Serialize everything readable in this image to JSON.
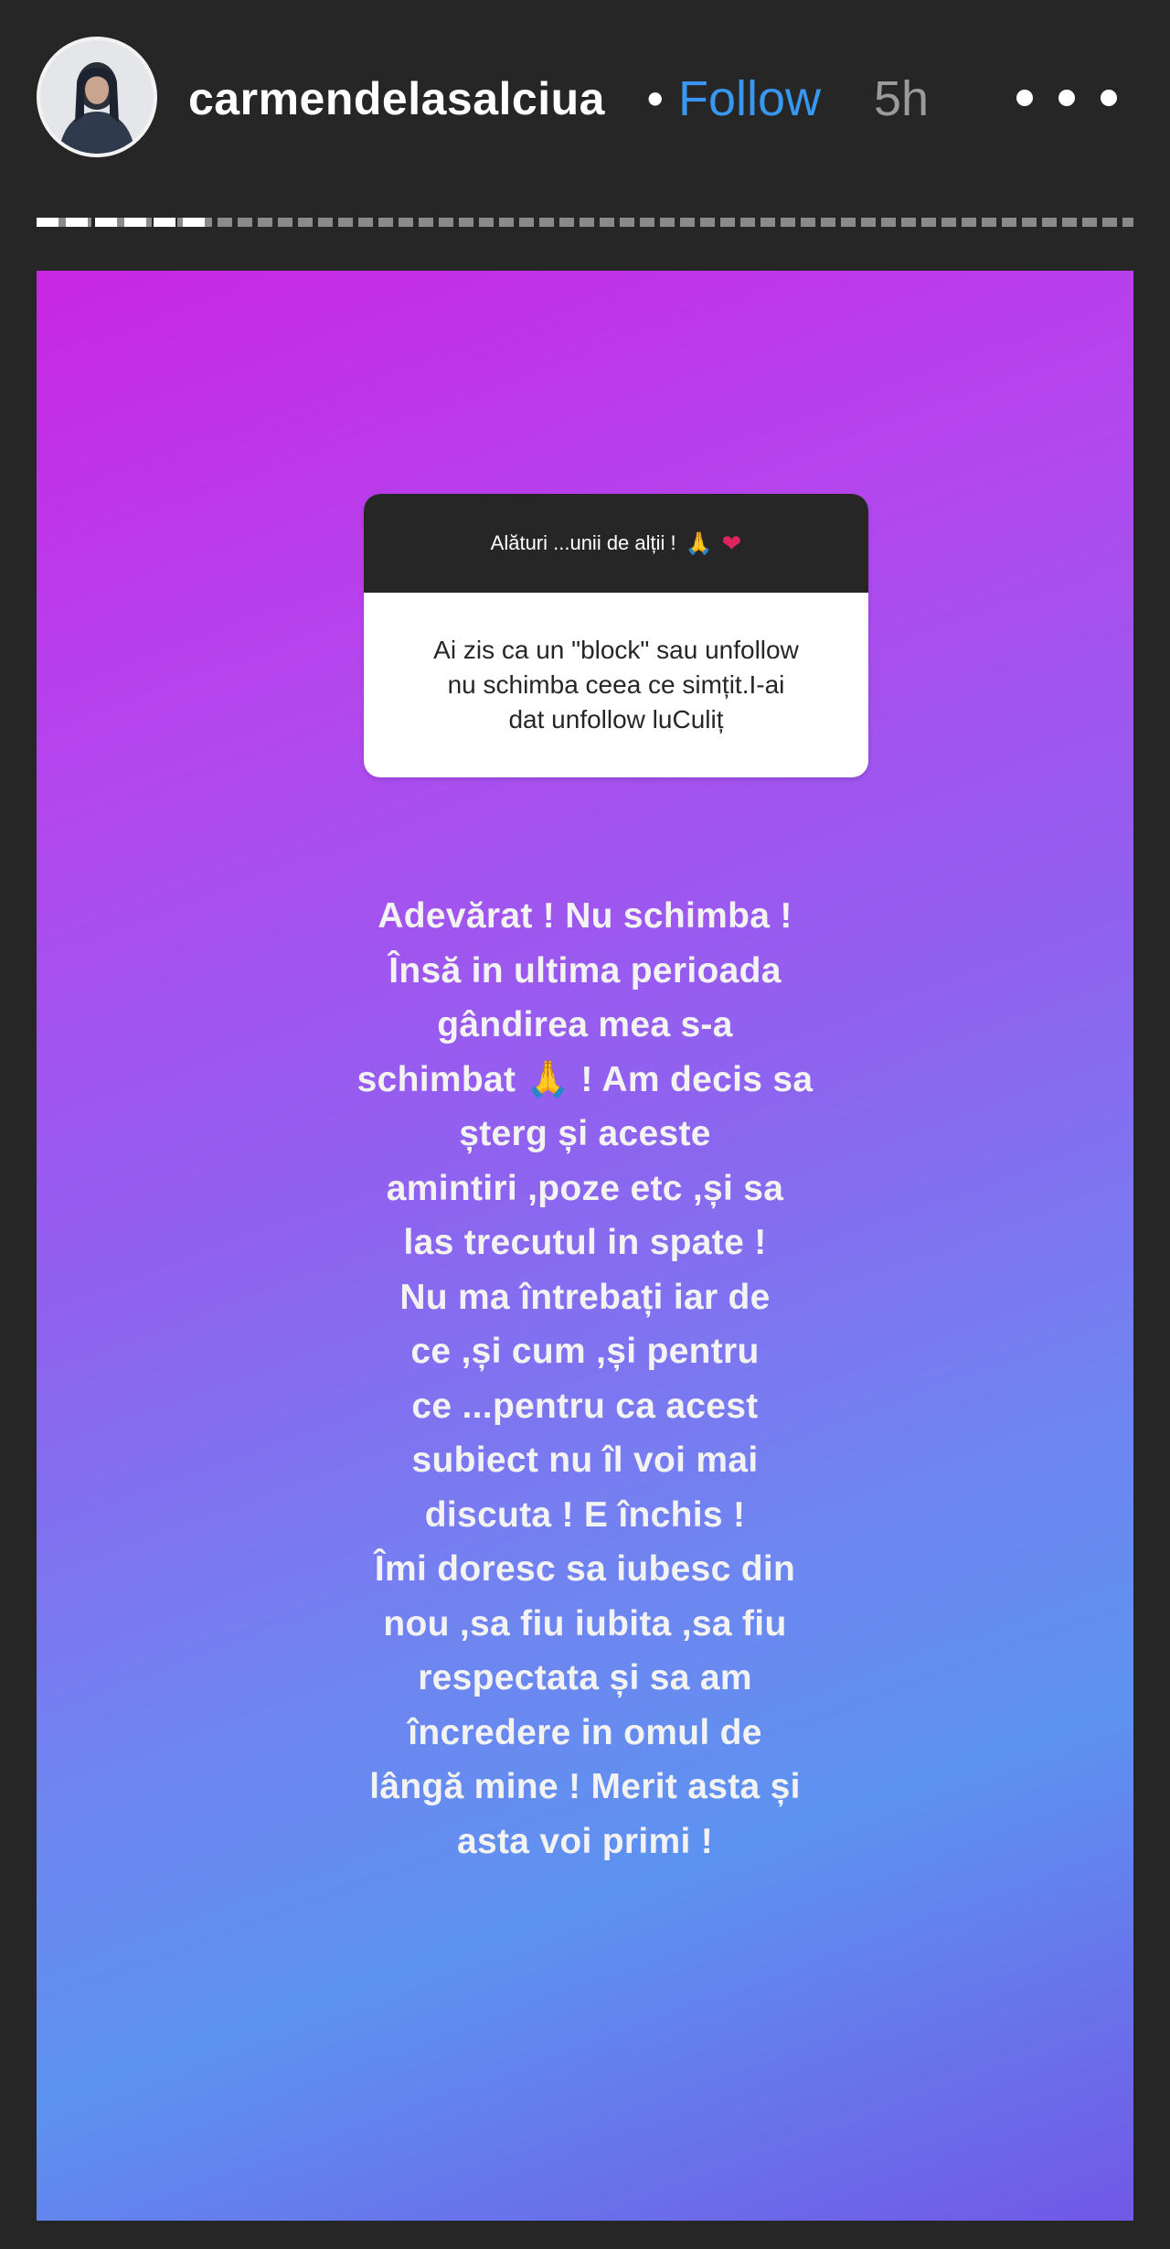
{
  "header": {
    "avatar_icon": "profile-avatar",
    "username": "carmendelasalciua",
    "separator": "•",
    "follow_label": "Follow",
    "time": "5h",
    "more_icon": "more-options-icon"
  },
  "progress": {
    "segments_viewed_fraction": 0.16
  },
  "story": {
    "background_colors": [
      "#c826e3",
      "#8f62ef",
      "#5d93f0",
      "#7258e6"
    ],
    "question": {
      "prompt": "Alături ...unii de alții !",
      "prompt_icons": [
        "pray-icon",
        "heart-icon"
      ],
      "text": "Ai zis ca un \"block\" sau unfollow\nnu schimba ceea ce simțit.I-ai\ndat unfollow luCuliț"
    },
    "answer": "Adevărat ! Nu schimba !\nÎnsă in ultima perioada\ngândirea mea s-a\nschimbat 🙏 ! Am decis sa\nșterg  și aceste\namintiri ,poze etc ,și sa\nlas trecutul in spate !\nNu ma întrebați iar de\nce ,și cum ,și pentru\nce ...pentru ca acest\nsubiect nu îl voi mai\ndiscuta ! E închis !\nÎmi doresc sa iubesc din\nnou ,sa fiu iubita ,sa fiu\nrespectata și sa am\nîncredere in omul de\nlângă mine ! Merit asta și\nasta voi primi !"
  }
}
